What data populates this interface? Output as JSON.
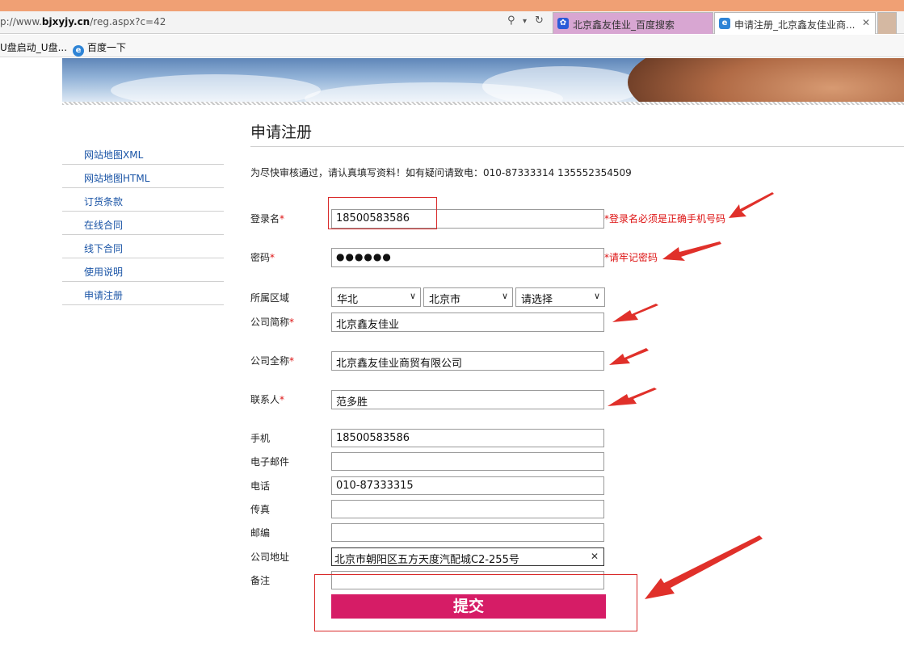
{
  "browser": {
    "url_prefix": "p://www.",
    "url_domain": "bjxyjy.cn",
    "url_path": "/reg.aspx?c=42",
    "search_icon": "search-icon",
    "tabs": [
      {
        "label": "北京鑫友佳业_百度搜索",
        "favicon": "baidu-paw-icon"
      },
      {
        "label": "申请注册_北京鑫友佳业商...",
        "favicon": "ie-icon",
        "active": true
      }
    ],
    "favorites": [
      {
        "label": "U盘启动_U盘..."
      },
      {
        "label": "百度一下"
      }
    ]
  },
  "sidebar": {
    "items": [
      {
        "label": "网站地图XML"
      },
      {
        "label": "网站地图HTML"
      },
      {
        "label": "订货条款"
      },
      {
        "label": "在线合同"
      },
      {
        "label": "线下合同"
      },
      {
        "label": "使用说明"
      },
      {
        "label": "申请注册"
      }
    ]
  },
  "form": {
    "title": "申请注册",
    "notice": "为尽快审核通过，请认真填写资料！如有疑问请致电：010-87333314 135552354509",
    "required_mark": "*",
    "login": {
      "label": "登录名",
      "value": "18500583586",
      "hint": "*登录名必须是正确手机号码"
    },
    "password": {
      "label": "密码",
      "value": "●●●●●●",
      "hint": "*请牢记密码"
    },
    "region": {
      "label": "所属区域",
      "selects": [
        "华北",
        "北京市",
        "请选择"
      ]
    },
    "short_name": {
      "label": "公司简称",
      "value": "北京鑫友佳业"
    },
    "full_name": {
      "label": "公司全称",
      "value": "北京鑫友佳业商贸有限公司"
    },
    "contact": {
      "label": "联系人",
      "value": "范多胜"
    },
    "mobile": {
      "label": "手机",
      "value": "18500583586"
    },
    "email": {
      "label": "电子邮件",
      "value": ""
    },
    "phone": {
      "label": "电话",
      "value": "010-87333315"
    },
    "fax": {
      "label": "传真",
      "value": ""
    },
    "zip": {
      "label": "邮编",
      "value": ""
    },
    "address": {
      "label": "公司地址",
      "value": "北京市朝阳区五方天度汽配城C2-255号"
    },
    "remark": {
      "label": "备注",
      "value": ""
    },
    "submit_label": "提交"
  },
  "colors": {
    "submit_bg": "#d61c66",
    "annotation_red": "#e0302a",
    "link_blue": "#1a54a6",
    "required_red": "#dd1111"
  }
}
